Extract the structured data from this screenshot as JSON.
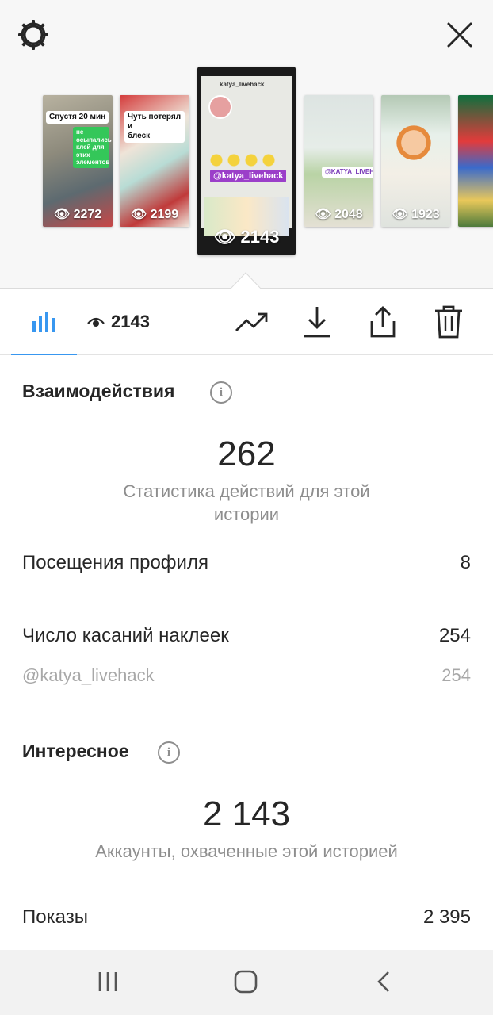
{
  "header": {
    "settings_icon": "gear-icon",
    "close_icon": "close-icon"
  },
  "stories": [
    {
      "views": "2272",
      "caption": "Спустя 20 мин",
      "caption2": "не осыпались\nклей для этих\nэлементов"
    },
    {
      "views": "2199",
      "caption": "Чуть потерял и\nблеск"
    },
    {
      "views": "2143",
      "username": "@katya_livehack",
      "profile_handle": "katya_livehack"
    },
    {
      "views": "2048",
      "tag": "@KATYA_LIVEHACK"
    },
    {
      "views": "1923"
    },
    {
      "views": ""
    }
  ],
  "toolbar": {
    "insights_icon": "bar-chart-icon",
    "view_count": "2143",
    "promote_icon": "trending-up-icon",
    "download_icon": "download-icon",
    "share_icon": "share-icon",
    "delete_icon": "trash-icon"
  },
  "interactions": {
    "title": "Взаимодействия",
    "total": "262",
    "subtitle": "Статистика действий для этой истории",
    "rows": [
      {
        "label": "Посещения профиля",
        "value": "8"
      },
      {
        "label": "Число касаний наклеек",
        "value": "254"
      },
      {
        "label": "@katya_livehack",
        "value": "254"
      }
    ]
  },
  "discovery": {
    "title": "Интересное",
    "total": "2 143",
    "subtitle": "Аккаунты, охваченные этой историей",
    "rows": [
      {
        "label": "Показы",
        "value": "2 395"
      }
    ]
  },
  "navbar": {
    "recents_icon": "recents-icon",
    "home_icon": "home-icon",
    "back_icon": "back-icon"
  },
  "colors": {
    "accent": "#3897f0",
    "text": "#262626",
    "secondary": "#8e8e8e"
  }
}
